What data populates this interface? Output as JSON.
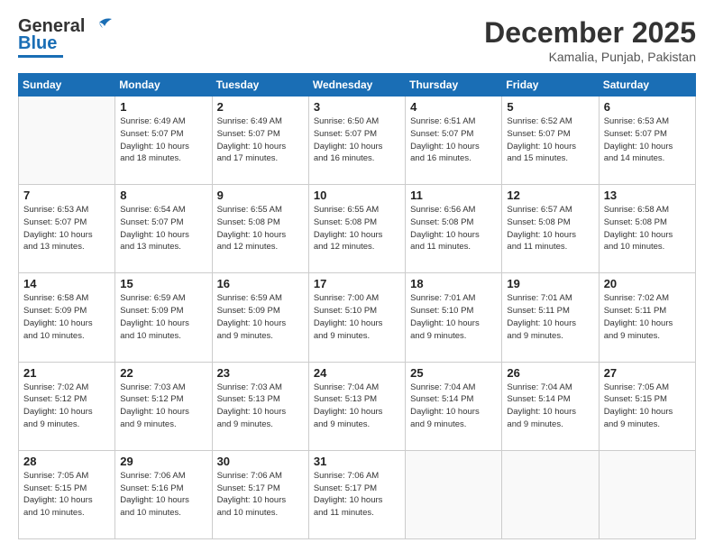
{
  "header": {
    "logo_text_general": "General",
    "logo_text_blue": "Blue",
    "month_title": "December 2025",
    "subtitle": "Kamalia, Punjab, Pakistan"
  },
  "days_of_week": [
    "Sunday",
    "Monday",
    "Tuesday",
    "Wednesday",
    "Thursday",
    "Friday",
    "Saturday"
  ],
  "weeks": [
    [
      {
        "day": "",
        "info": ""
      },
      {
        "day": "1",
        "info": "Sunrise: 6:49 AM\nSunset: 5:07 PM\nDaylight: 10 hours\nand 18 minutes."
      },
      {
        "day": "2",
        "info": "Sunrise: 6:49 AM\nSunset: 5:07 PM\nDaylight: 10 hours\nand 17 minutes."
      },
      {
        "day": "3",
        "info": "Sunrise: 6:50 AM\nSunset: 5:07 PM\nDaylight: 10 hours\nand 16 minutes."
      },
      {
        "day": "4",
        "info": "Sunrise: 6:51 AM\nSunset: 5:07 PM\nDaylight: 10 hours\nand 16 minutes."
      },
      {
        "day": "5",
        "info": "Sunrise: 6:52 AM\nSunset: 5:07 PM\nDaylight: 10 hours\nand 15 minutes."
      },
      {
        "day": "6",
        "info": "Sunrise: 6:53 AM\nSunset: 5:07 PM\nDaylight: 10 hours\nand 14 minutes."
      }
    ],
    [
      {
        "day": "7",
        "info": "Sunrise: 6:53 AM\nSunset: 5:07 PM\nDaylight: 10 hours\nand 13 minutes."
      },
      {
        "day": "8",
        "info": "Sunrise: 6:54 AM\nSunset: 5:07 PM\nDaylight: 10 hours\nand 13 minutes."
      },
      {
        "day": "9",
        "info": "Sunrise: 6:55 AM\nSunset: 5:08 PM\nDaylight: 10 hours\nand 12 minutes."
      },
      {
        "day": "10",
        "info": "Sunrise: 6:55 AM\nSunset: 5:08 PM\nDaylight: 10 hours\nand 12 minutes."
      },
      {
        "day": "11",
        "info": "Sunrise: 6:56 AM\nSunset: 5:08 PM\nDaylight: 10 hours\nand 11 minutes."
      },
      {
        "day": "12",
        "info": "Sunrise: 6:57 AM\nSunset: 5:08 PM\nDaylight: 10 hours\nand 11 minutes."
      },
      {
        "day": "13",
        "info": "Sunrise: 6:58 AM\nSunset: 5:08 PM\nDaylight: 10 hours\nand 10 minutes."
      }
    ],
    [
      {
        "day": "14",
        "info": "Sunrise: 6:58 AM\nSunset: 5:09 PM\nDaylight: 10 hours\nand 10 minutes."
      },
      {
        "day": "15",
        "info": "Sunrise: 6:59 AM\nSunset: 5:09 PM\nDaylight: 10 hours\nand 10 minutes."
      },
      {
        "day": "16",
        "info": "Sunrise: 6:59 AM\nSunset: 5:09 PM\nDaylight: 10 hours\nand 9 minutes."
      },
      {
        "day": "17",
        "info": "Sunrise: 7:00 AM\nSunset: 5:10 PM\nDaylight: 10 hours\nand 9 minutes."
      },
      {
        "day": "18",
        "info": "Sunrise: 7:01 AM\nSunset: 5:10 PM\nDaylight: 10 hours\nand 9 minutes."
      },
      {
        "day": "19",
        "info": "Sunrise: 7:01 AM\nSunset: 5:11 PM\nDaylight: 10 hours\nand 9 minutes."
      },
      {
        "day": "20",
        "info": "Sunrise: 7:02 AM\nSunset: 5:11 PM\nDaylight: 10 hours\nand 9 minutes."
      }
    ],
    [
      {
        "day": "21",
        "info": "Sunrise: 7:02 AM\nSunset: 5:12 PM\nDaylight: 10 hours\nand 9 minutes."
      },
      {
        "day": "22",
        "info": "Sunrise: 7:03 AM\nSunset: 5:12 PM\nDaylight: 10 hours\nand 9 minutes."
      },
      {
        "day": "23",
        "info": "Sunrise: 7:03 AM\nSunset: 5:13 PM\nDaylight: 10 hours\nand 9 minutes."
      },
      {
        "day": "24",
        "info": "Sunrise: 7:04 AM\nSunset: 5:13 PM\nDaylight: 10 hours\nand 9 minutes."
      },
      {
        "day": "25",
        "info": "Sunrise: 7:04 AM\nSunset: 5:14 PM\nDaylight: 10 hours\nand 9 minutes."
      },
      {
        "day": "26",
        "info": "Sunrise: 7:04 AM\nSunset: 5:14 PM\nDaylight: 10 hours\nand 9 minutes."
      },
      {
        "day": "27",
        "info": "Sunrise: 7:05 AM\nSunset: 5:15 PM\nDaylight: 10 hours\nand 9 minutes."
      }
    ],
    [
      {
        "day": "28",
        "info": "Sunrise: 7:05 AM\nSunset: 5:15 PM\nDaylight: 10 hours\nand 10 minutes."
      },
      {
        "day": "29",
        "info": "Sunrise: 7:06 AM\nSunset: 5:16 PM\nDaylight: 10 hours\nand 10 minutes."
      },
      {
        "day": "30",
        "info": "Sunrise: 7:06 AM\nSunset: 5:17 PM\nDaylight: 10 hours\nand 10 minutes."
      },
      {
        "day": "31",
        "info": "Sunrise: 7:06 AM\nSunset: 5:17 PM\nDaylight: 10 hours\nand 11 minutes."
      },
      {
        "day": "",
        "info": ""
      },
      {
        "day": "",
        "info": ""
      },
      {
        "day": "",
        "info": ""
      }
    ]
  ]
}
